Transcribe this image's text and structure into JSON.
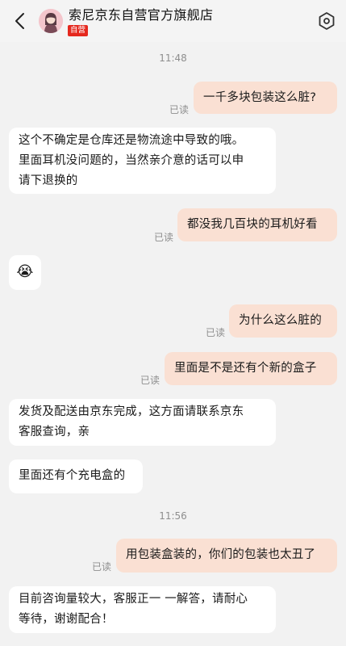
{
  "header": {
    "shop_name": "索尼京东自营官方旗舰店",
    "badge": "自营",
    "icons": {
      "back": "chevron-left-icon",
      "settings": "settings-hexagon-icon"
    },
    "accent_color": "#e5281e"
  },
  "chat": {
    "time1": "11:48",
    "time2": "11:56",
    "read_label": "已读",
    "messages": [
      {
        "side": "right",
        "text": "一千多块包装这么脏?"
      },
      {
        "side": "left",
        "lines": [
          "这个不确定是仓库还是物流途中导致的哦。",
          "里面耳机没问题的，当然亲介意的话可以申",
          "请下退换的"
        ]
      },
      {
        "side": "right",
        "text": "都没我几百块的耳机好看"
      },
      {
        "side": "left",
        "emoji": "😭"
      },
      {
        "side": "right",
        "text": "为什么这么脏的"
      },
      {
        "side": "right",
        "text": "里面是不是还有个新的盒子"
      },
      {
        "side": "left",
        "lines": [
          "发货及配送由京东完成，这方面请联系京东",
          "客服查询，亲"
        ]
      },
      {
        "side": "left",
        "text": "里面还有个充电盒的"
      },
      {
        "side": "right",
        "text": "用包装盒装的，你们的包装也太丑了"
      },
      {
        "side": "left",
        "lines": [
          "目前咨询量较大，客服正一 一解答，请耐心",
          "等待，谢谢配合！"
        ]
      }
    ],
    "bubble_colors": {
      "mine": "#fae0d3",
      "theirs": "#ffffff"
    }
  }
}
